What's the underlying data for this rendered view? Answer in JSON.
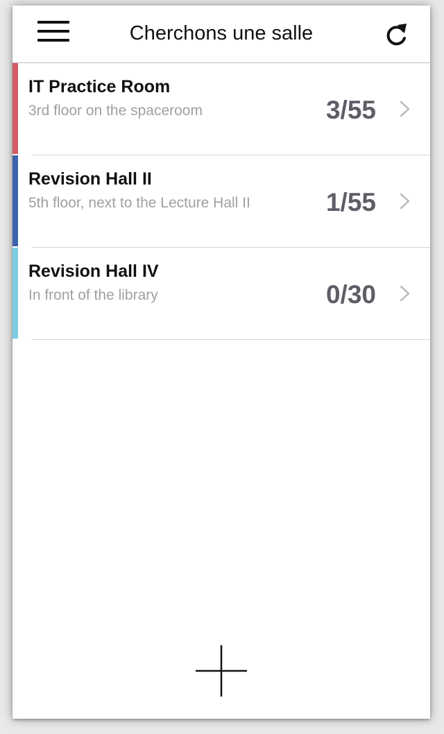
{
  "header": {
    "title": "Cherchons une salle",
    "menu_icon": "hamburger-menu-icon",
    "refresh_icon": "refresh-icon"
  },
  "rooms": [
    {
      "name": "IT Practice Room",
      "location": "3rd floor on the spaceroom",
      "occupancy": "3/55",
      "accent_color": "#d45a64"
    },
    {
      "name": "Revision Hall II",
      "location": "5th floor, next to the Lecture Hall II",
      "occupancy": "1/55",
      "accent_color": "#3d62ad"
    },
    {
      "name": "Revision Hall IV",
      "location": "In front of the library",
      "occupancy": "0/30",
      "accent_color": "#7ccee1"
    }
  ],
  "footer": {
    "add_icon": "plus-icon"
  }
}
